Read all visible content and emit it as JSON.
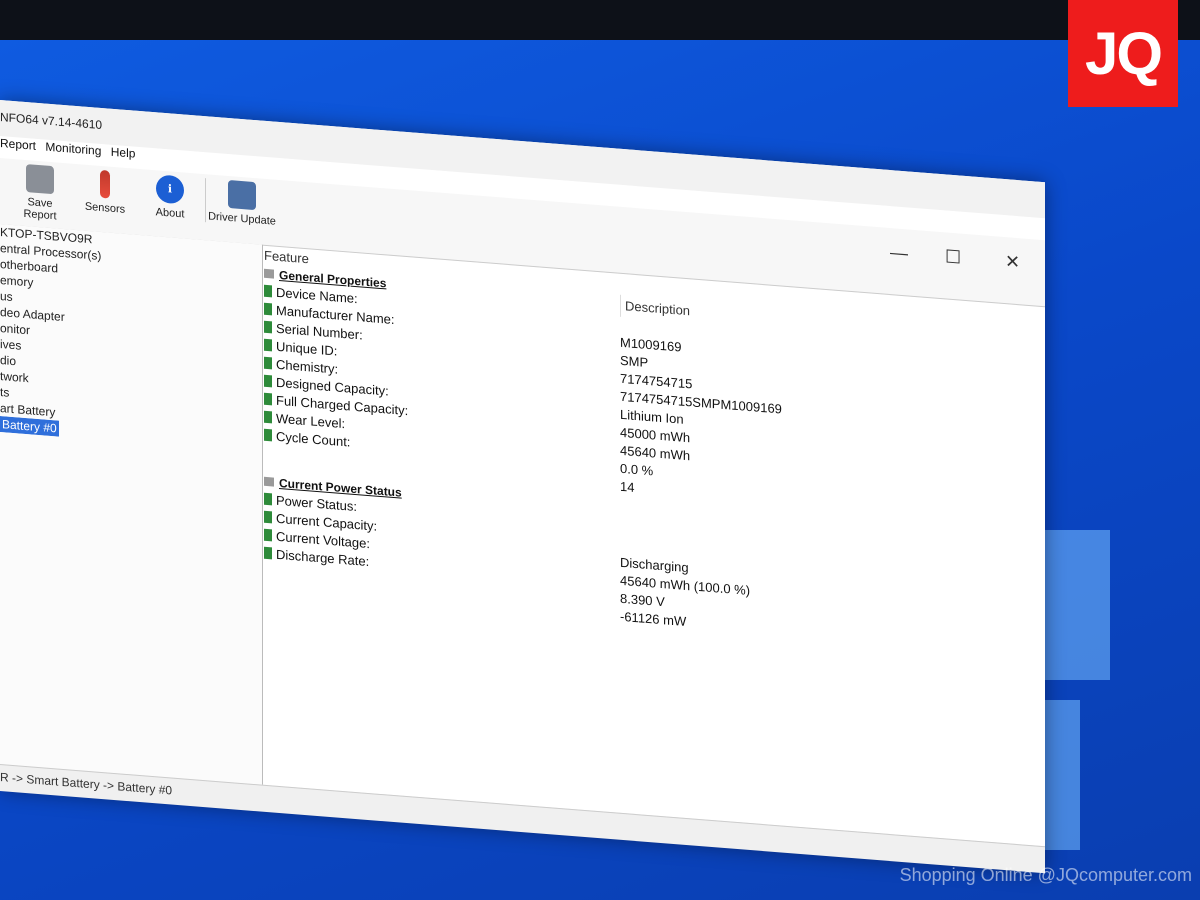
{
  "title": "NFO64 v7.14-4610",
  "menu": [
    "Report",
    "Monitoring",
    "Help"
  ],
  "toolbar": [
    {
      "label": "Save Report",
      "icon": "save-icon"
    },
    {
      "label": "Sensors",
      "icon": "thermometer-icon"
    },
    {
      "label": "About",
      "icon": "info-icon"
    },
    {
      "label": "Driver Update",
      "icon": "driver-update-icon"
    }
  ],
  "window_controls": {
    "minimize": "—",
    "maximize": "☐",
    "close": "✕"
  },
  "tree": [
    "KTOP-TSBVO9R",
    "entral Processor(s)",
    "otherboard",
    "emory",
    "us",
    "deo Adapter",
    "onitor",
    "ives",
    "dio",
    "twork",
    "ts",
    "art Battery",
    "Battery #0"
  ],
  "columns": {
    "feature": "Feature",
    "description": "Description"
  },
  "groups": [
    {
      "name": "General Properties",
      "rows": [
        {
          "label": "Device Name:",
          "value": "M1009169"
        },
        {
          "label": "Manufacturer Name:",
          "value": "SMP"
        },
        {
          "label": "Serial Number:",
          "value": "7174754715"
        },
        {
          "label": "Unique ID:",
          "value": "7174754715SMPM1009169"
        },
        {
          "label": "Chemistry:",
          "value": "Lithium Ion"
        },
        {
          "label": "Designed Capacity:",
          "value": "45000 mWh"
        },
        {
          "label": "Full Charged Capacity:",
          "value": "45640 mWh"
        },
        {
          "label": "Wear Level:",
          "value": "0.0 %"
        },
        {
          "label": "Cycle Count:",
          "value": "14"
        }
      ]
    },
    {
      "name": "Current Power Status",
      "rows": [
        {
          "label": "Power Status:",
          "value": "Discharging"
        },
        {
          "label": "Current Capacity:",
          "value": "45640 mWh (100.0 %)"
        },
        {
          "label": "Current Voltage:",
          "value": "8.390 V"
        },
        {
          "label": "Discharge Rate:",
          "value": "-61126 mW"
        }
      ]
    }
  ],
  "statusbar": "R -> Smart Battery -> Battery #0",
  "badge": "JQ",
  "watermark": "Shopping Online @JQcomputer.com"
}
